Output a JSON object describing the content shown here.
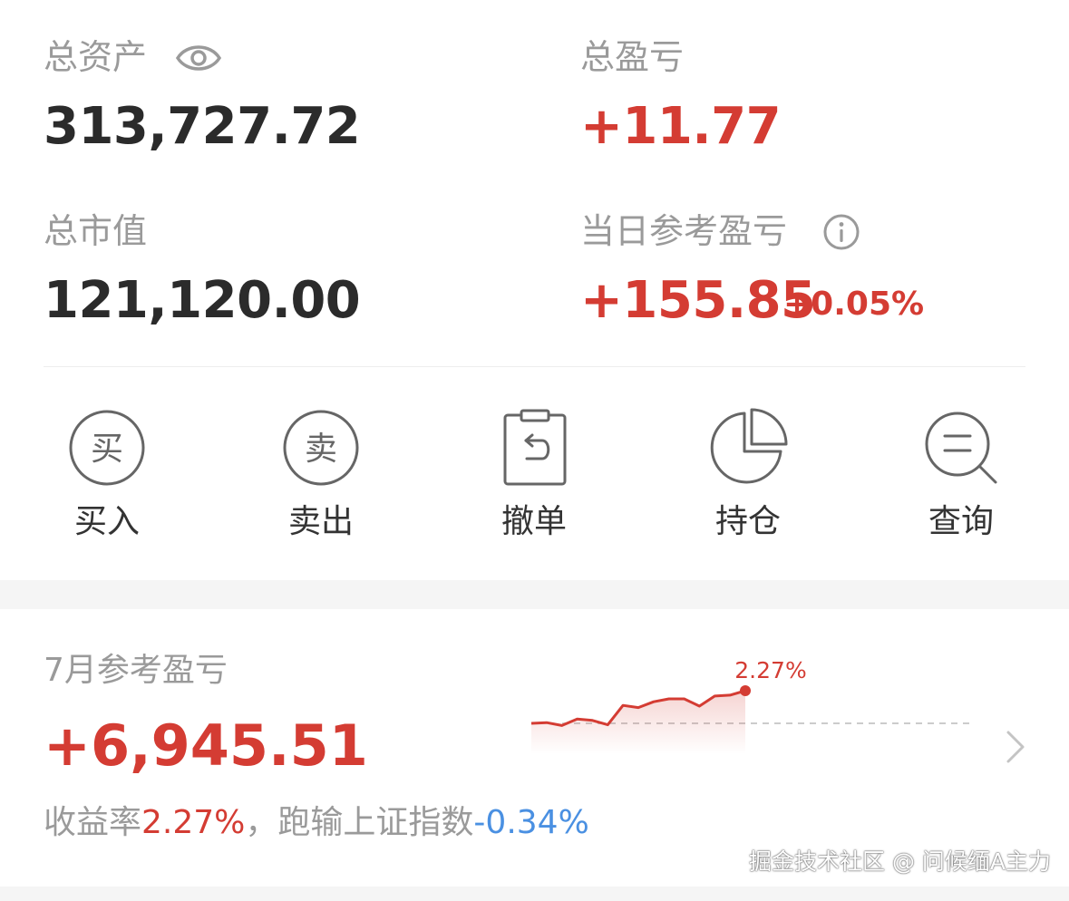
{
  "summary": {
    "total_assets_label": "总资产",
    "total_assets_value": "313,727.72",
    "total_pnl_label": "总盈亏",
    "total_pnl_value": "+11.77",
    "market_value_label": "总市值",
    "market_value_value": "121,120.00",
    "today_pnl_label": "当日参考盈亏",
    "today_pnl_value": "+155.85",
    "today_pnl_pct": "+0.05%"
  },
  "actions": [
    {
      "label": "买入",
      "glyph": "买",
      "icon": "buy-icon"
    },
    {
      "label": "卖出",
      "glyph": "卖",
      "icon": "sell-icon"
    },
    {
      "label": "撤单",
      "icon": "cancel-order-icon"
    },
    {
      "label": "持仓",
      "icon": "pie-chart-icon"
    },
    {
      "label": "查询",
      "icon": "search-icon"
    }
  ],
  "monthly": {
    "label": "7月参考盈亏",
    "value": "+6,945.51",
    "yield_label": "收益率",
    "yield_value": "2.27%",
    "separator": "，",
    "benchmark_label": "跑输上证指数",
    "benchmark_value": "-0.34%",
    "chart_end_label": "2.27%"
  },
  "chart_data": {
    "type": "area",
    "values": [
      0.0,
      0.05,
      -0.15,
      0.3,
      0.2,
      -0.1,
      1.25,
      1.1,
      1.5,
      1.7,
      1.7,
      1.2,
      1.9,
      1.96,
      2.27
    ],
    "baseline": 0,
    "end_label": "2.27%"
  },
  "watermark": "掘金技术社区 @ 问候缅A主力",
  "colors": {
    "up": "#d43c33",
    "down": "#4a90e2",
    "label": "#9a9a9a",
    "text": "#2b2b2b",
    "icon": "#666666",
    "background_gap": "#f5f5f5"
  }
}
